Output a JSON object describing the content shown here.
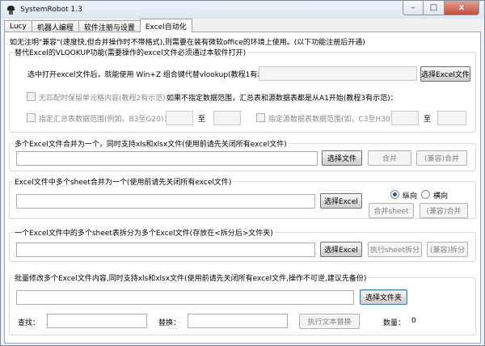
{
  "window": {
    "title": "SystemRobot 1.3",
    "minimize": "–",
    "maximize": "□",
    "close": "x"
  },
  "tabs": [
    "Lucy",
    "机器人编程",
    "软件注册与设置",
    "Excel自动化"
  ],
  "notice": "如无注明\"兼容\"(速度快,但合并操作时不带格式),则需要在装有微软office的环境上使用。(以下功能注册后开通)",
  "vlookup": {
    "legend": "替代Excel的VLOOKUP功能(需要操作的excel文件必须通过本软件打开)",
    "instruction": "选中打开excel文件后，就能使用 Win+Z 组合键代替vlookup(教程1有示范)",
    "select_button": "选择Excel文件",
    "keep_format_label": "无匹配时保留单元格内容(教程2有示范)",
    "range_note": "如果不指定数据范围，汇总表和源数据表都是从A1开始(教程3有示范)：",
    "summary_range_label": "指定汇总表数据范围(例如，B3至G20)：",
    "to1": "至",
    "source_range_label": "指定源数据表数据范围(如，C3至H30)：",
    "to2": "至"
  },
  "merge_files": {
    "legend": "多个Excel文件合并为一个，同时支持xls和xlsx文件(使用前请先关闭所有excel文件)",
    "select_button": "选择文件",
    "merge_button": "合并",
    "compat_merge_button": "(兼容)合并"
  },
  "merge_sheets": {
    "legend": "Excel文件中多个sheet合并为一个(使用前请先关闭所有excel文件)",
    "select_button": "选择Excel",
    "vertical_label": "纵向",
    "horizontal_label": "横向",
    "orientation_selected": "vertical",
    "merge_sheet_button": "合并sheet",
    "compat_merge_button": "(兼容)合并"
  },
  "split_sheets": {
    "legend": "一个Excel文件中的多个sheet表拆分为多个Excel文件(存放在<拆分后>文件夹)",
    "select_button": "选择Excel",
    "split_button": "执行sheet拆分",
    "compat_split_button": "(兼容)拆分"
  },
  "batch_replace": {
    "legend": "批量修改多个Excel文件内容,同时支持xls和xlsx文件(使用前请先关闭所有excel文件,操作不可逆,建议先备份)",
    "select_folder_button": "选择文件夹",
    "find_label": "查找：",
    "replace_label": "替换：",
    "replace_button": "执行文本替换",
    "count_label": "数量：",
    "count_value": "0"
  }
}
